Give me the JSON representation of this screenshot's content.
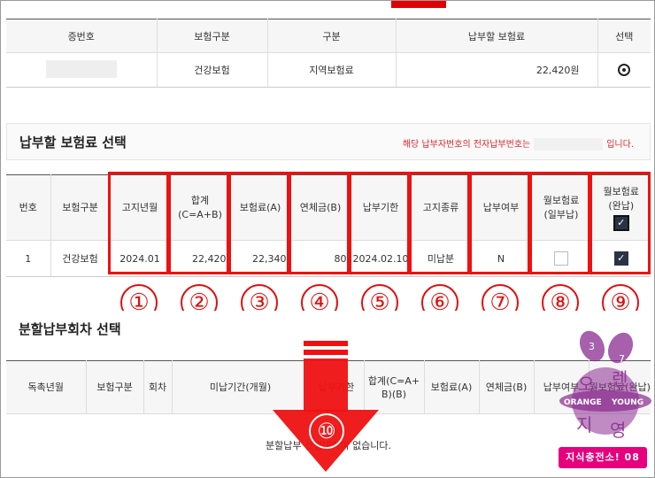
{
  "top_table": {
    "headers": [
      "증번호",
      "보험구분",
      "구분",
      "납부할 보험료",
      "선택"
    ],
    "row": {
      "insurance_type": "건강보험",
      "category": "지역보험료",
      "amount": "22,420원"
    }
  },
  "payment_section": {
    "title": "납부할 보험료 선택",
    "notice_prefix": "해당 납부자번호의 전자납부번호는",
    "notice_suffix": "입니다."
  },
  "payment_table": {
    "headers": {
      "no": "번호",
      "type": "보험구분",
      "notice_month": "고지년월",
      "total_1": "합계",
      "total_2": "(C=A+B)",
      "premium": "보험료(A)",
      "overdue": "연체금(B)",
      "due_date": "납부기한",
      "notice_kind": "고지종류",
      "paid": "납부여부",
      "monthly_partial_1": "월보험료",
      "monthly_partial_2": "(일부납)",
      "monthly_full_1": "월보험료",
      "monthly_full_2": "(완납)"
    },
    "row": {
      "no": "1",
      "type": "건강보험",
      "notice_month": "2024.01",
      "total": "22,420",
      "premium": "22,340",
      "overdue": "80",
      "due_date": "2024.02.10",
      "notice_kind": "미납분",
      "paid": "N"
    }
  },
  "circle_numbers": [
    "①",
    "②",
    "③",
    "④",
    "⑤",
    "⑥",
    "⑦",
    "⑧",
    "⑨",
    "⑩"
  ],
  "installment_section": {
    "title": "분할납부회차 선택"
  },
  "installment_table": {
    "headers": {
      "c1": "독촉년월",
      "c2": "보험구분",
      "c3": "회차",
      "c4": "미납기간(개월)",
      "c5": "납부기한",
      "c6_1": "합계(C=A+",
      "c6_2": "B)(B)",
      "c7": "보험료(A)",
      "c8": "연체금(B)",
      "c9": "납부여부",
      "c10": "월보험료(완납)"
    },
    "empty_message": "분할납부 신청내역이 없습니다."
  },
  "watermark": {
    "numbers": [
      "3",
      "7"
    ],
    "ring_text_left": "ORANGE",
    "ring_text_right": "YOUNG",
    "syllables": [
      "오",
      "렌",
      "지",
      "영"
    ],
    "badge": "지식충전소! 08"
  },
  "colors": {
    "highlight": "#ee1111",
    "notice": "#e0262c",
    "badge": "#e6007e",
    "logo": "#8a2b8f"
  }
}
